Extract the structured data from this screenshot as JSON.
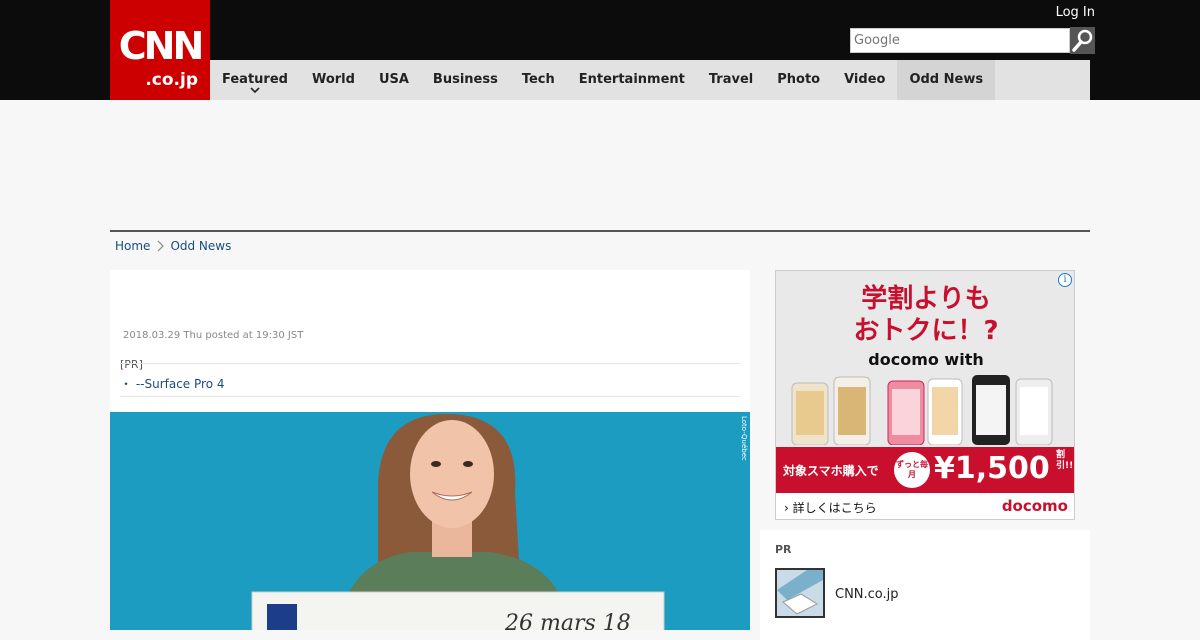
{
  "header": {
    "logo_main": "CNN",
    "logo_sub": ".co.jp",
    "login_label": "Log In",
    "search_placeholder": "Google",
    "nav": [
      {
        "label": "Featured"
      },
      {
        "label": "World"
      },
      {
        "label": "USA"
      },
      {
        "label": "Business"
      },
      {
        "label": "Tech"
      },
      {
        "label": "Entertainment"
      },
      {
        "label": "Travel"
      },
      {
        "label": "Photo"
      },
      {
        "label": "Video"
      },
      {
        "label": "Odd News",
        "active": true
      }
    ]
  },
  "breadcrumb": [
    "Home",
    "Odd News"
  ],
  "article": {
    "date": "2018.03.29 Thu posted at 19:30 JST",
    "pr_label": "[PR]",
    "pr_link": "・ --Surface Pro 4",
    "photo_credit": "Loto-Québec",
    "photo_check_date": "26 mars 18"
  },
  "ad": {
    "info_icon": "i",
    "headline_1": "学割よりも",
    "headline_2": "おトクに！?",
    "brand": "docomo with",
    "band_text": "対象スマホ購入で",
    "badge": "ずっと毎月",
    "price": "¥1,500",
    "price_suffix": "割引!!!",
    "more": "› 詳しくはこちら",
    "logo": "docomo",
    "colors": {
      "red": "#c8102e"
    }
  },
  "pr_panel": {
    "title": "PR",
    "item": "CNN.co.jp"
  }
}
